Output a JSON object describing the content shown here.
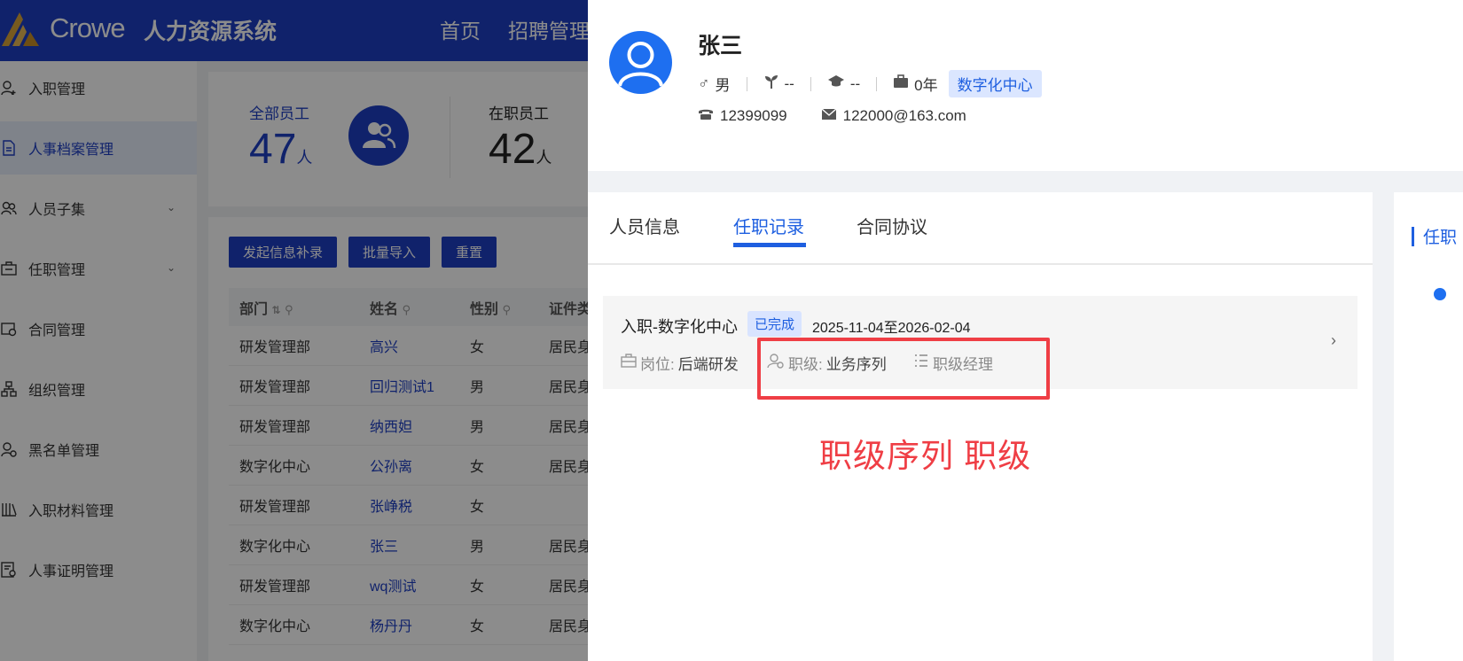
{
  "app": {
    "brand": "Crowe",
    "system_name": "人力资源系统",
    "nav": [
      "首页",
      "招聘管理"
    ]
  },
  "sidebar": {
    "items": [
      {
        "label": "入职管理",
        "icon": "user-add-icon"
      },
      {
        "label": "人事档案管理",
        "icon": "document-icon",
        "active": true
      },
      {
        "label": "人员子集",
        "icon": "users-icon",
        "expandable": true
      },
      {
        "label": "任职管理",
        "icon": "briefcase-icon",
        "expandable": true
      },
      {
        "label": "合同管理",
        "icon": "contract-icon"
      },
      {
        "label": "组织管理",
        "icon": "org-tree-icon"
      },
      {
        "label": "黑名单管理",
        "icon": "user-block-icon"
      },
      {
        "label": "入职材料管理",
        "icon": "books-icon"
      },
      {
        "label": "人事证明管理",
        "icon": "certificate-icon"
      }
    ]
  },
  "stats": {
    "total_label": "全部员工",
    "total_value": "47",
    "active_label": "在职员工",
    "active_value": "42",
    "unit": "人"
  },
  "actions": {
    "supplement": "发起信息补录",
    "batch_import": "批量导入",
    "reset": "重置"
  },
  "table": {
    "headers": [
      "部门",
      "姓名",
      "性别",
      "证件类"
    ],
    "rows": [
      [
        "研发管理部",
        "高兴",
        "女",
        "居民身"
      ],
      [
        "研发管理部",
        "回归测试1",
        "男",
        "居民身"
      ],
      [
        "研发管理部",
        "纳西妲",
        "男",
        "居民身"
      ],
      [
        "数字化中心",
        "公孙离",
        "女",
        "居民身"
      ],
      [
        "研发管理部",
        "张峥税",
        "女",
        ""
      ],
      [
        "数字化中心",
        "张三",
        "男",
        "居民身"
      ],
      [
        "研发管理部",
        "wq测试",
        "女",
        "居民身"
      ],
      [
        "数字化中心",
        "杨丹丹",
        "女",
        "居民身"
      ]
    ]
  },
  "profile": {
    "name": "张三",
    "gender": "男",
    "political": "--",
    "education": "--",
    "years": "0年",
    "department": "数字化中心",
    "phone": "12399099",
    "email": "122000@163.com"
  },
  "tabs": {
    "info": "人员信息",
    "records": "任职记录",
    "contract": "合同协议"
  },
  "record": {
    "title": "入职-数字化中心",
    "status": "已完成",
    "date_range": "2025-11-04至2026-02-04",
    "post_label": "岗位:",
    "post_value": "后端研发",
    "grade_label": "职级:",
    "grade_value": "业务序列",
    "level_value": "职级经理"
  },
  "annotation": "职级序列  职级",
  "side_panel": {
    "title": "任职"
  },
  "colors": {
    "brand": "#1e3fc4",
    "accent": "#1e5fe0",
    "annotation": "#ef3e45"
  }
}
